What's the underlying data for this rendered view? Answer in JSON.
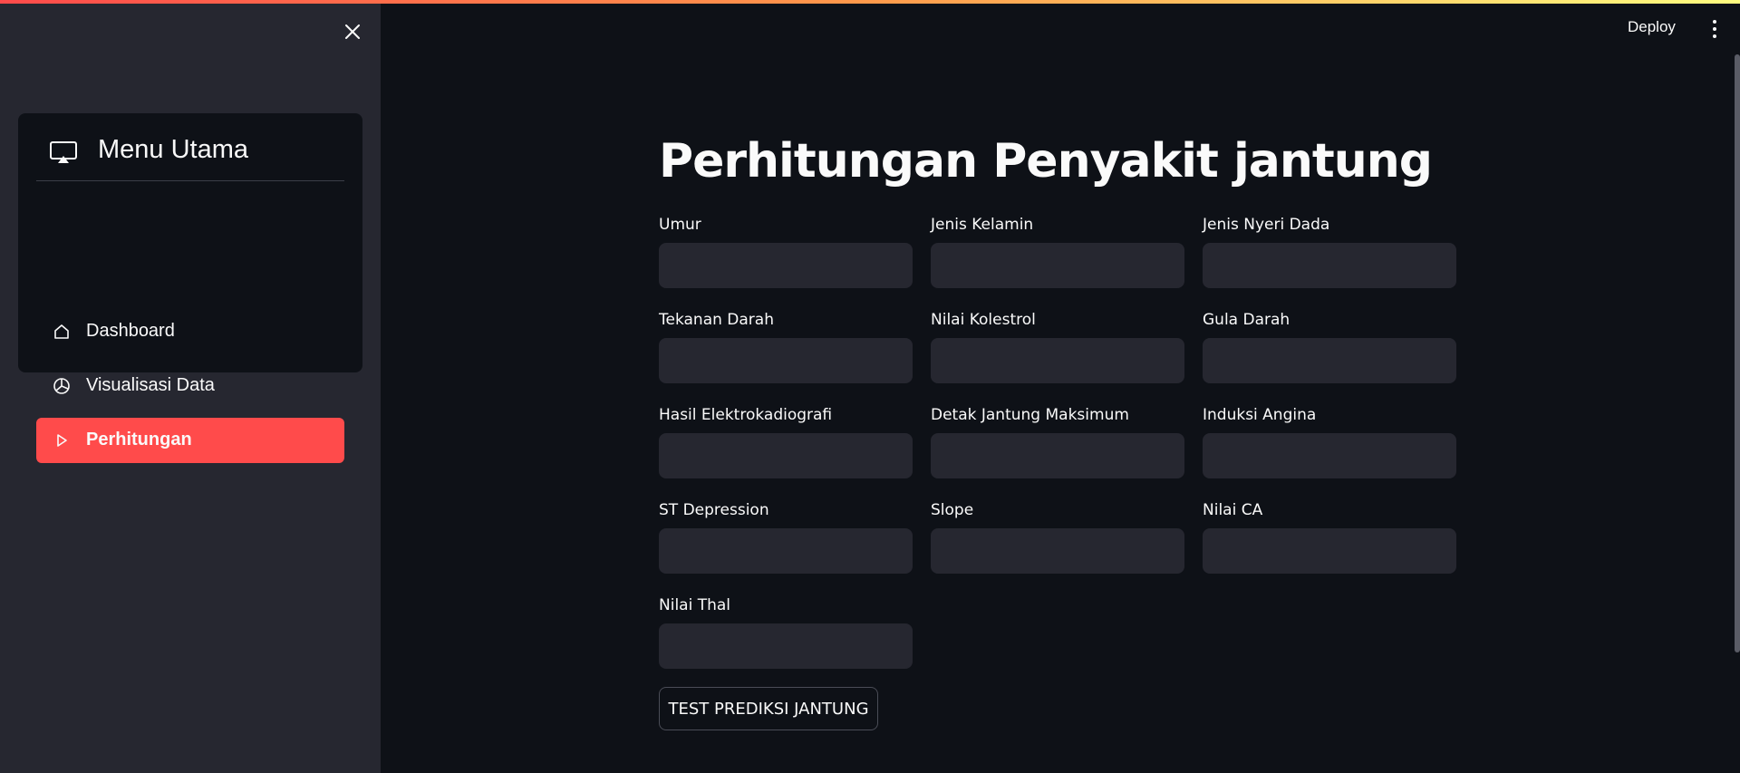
{
  "sidebar": {
    "menu": {
      "title": "Menu Utama",
      "items": [
        {
          "label": "Dashboard",
          "icon": "house-icon",
          "active": false
        },
        {
          "label": "Visualisasi Data",
          "icon": "pie-chart-icon",
          "active": false
        },
        {
          "label": "Perhitungan",
          "icon": "play-icon",
          "active": true
        }
      ]
    }
  },
  "header": {
    "deploy_label": "Deploy"
  },
  "main": {
    "title": "Perhitungan Penyakit jantung",
    "fields": [
      {
        "label": "Umur",
        "value": ""
      },
      {
        "label": "Jenis Kelamin",
        "value": ""
      },
      {
        "label": "Jenis Nyeri Dada",
        "value": ""
      },
      {
        "label": "Tekanan Darah",
        "value": ""
      },
      {
        "label": "Nilai Kolestrol",
        "value": ""
      },
      {
        "label": "Gula Darah",
        "value": ""
      },
      {
        "label": "Hasil Elektrokadiografi",
        "value": ""
      },
      {
        "label": "Detak Jantung Maksimum",
        "value": ""
      },
      {
        "label": "Induksi Angina",
        "value": ""
      },
      {
        "label": "ST Depression",
        "value": ""
      },
      {
        "label": "Slope",
        "value": ""
      },
      {
        "label": "Nilai CA",
        "value": ""
      },
      {
        "label": "Nilai Thal",
        "value": ""
      }
    ],
    "submit_label": "TEST PREDIKSI JANTUNG"
  },
  "colors": {
    "accent": "#ff4b4b",
    "background": "#0e1117",
    "sidebar": "#262730",
    "input": "#262730"
  }
}
